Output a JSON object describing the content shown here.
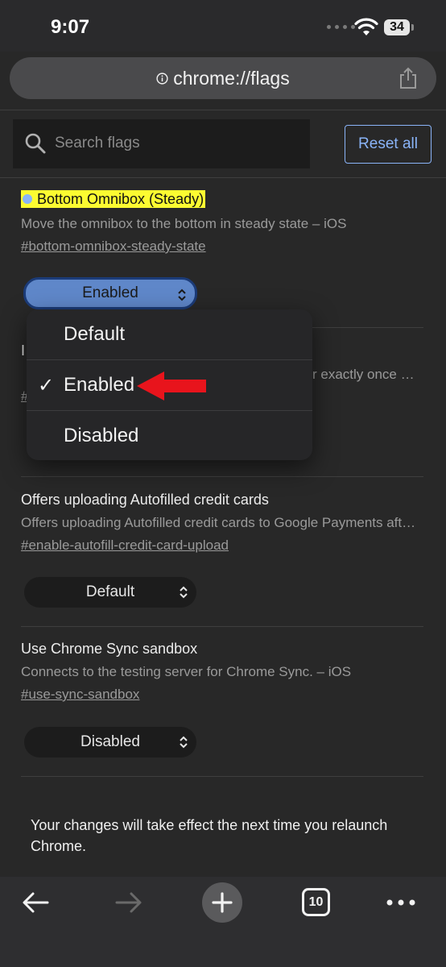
{
  "status_bar": {
    "time": "9:07",
    "battery": "34"
  },
  "address_bar": {
    "url": "chrome://flags"
  },
  "search": {
    "placeholder": "Search flags",
    "reset_label": "Reset all"
  },
  "flags": [
    {
      "title": "Bottom Omnibox (Steady)",
      "description": "Move the omnibox to the bottom in steady state – iOS",
      "link": "#bottom-omnibox-steady-state",
      "value": "Enabled"
    },
    {
      "title": "I",
      "description": "r exactly once …",
      "link": "#"
    },
    {
      "title": "Offers uploading Autofilled credit cards",
      "description": "Offers uploading Autofilled credit cards to Google Payments aft…",
      "link": "#enable-autofill-credit-card-upload",
      "value": "Default"
    },
    {
      "title": "Use Chrome Sync sandbox",
      "description": "Connects to the testing server for Chrome Sync. – iOS",
      "link": "#use-sync-sandbox",
      "value": "Disabled"
    }
  ],
  "dropdown": {
    "options": [
      "Default",
      "Enabled",
      "Disabled"
    ],
    "selected_index": 1,
    "check": "✓"
  },
  "footer": {
    "message": "Your changes will take effect the next time you relaunch Chrome."
  },
  "toolbar": {
    "tab_count": "10"
  },
  "colors": {
    "accent": "#8ab4f8",
    "highlight": "#fcfb31",
    "arrow": "#e8141c"
  }
}
